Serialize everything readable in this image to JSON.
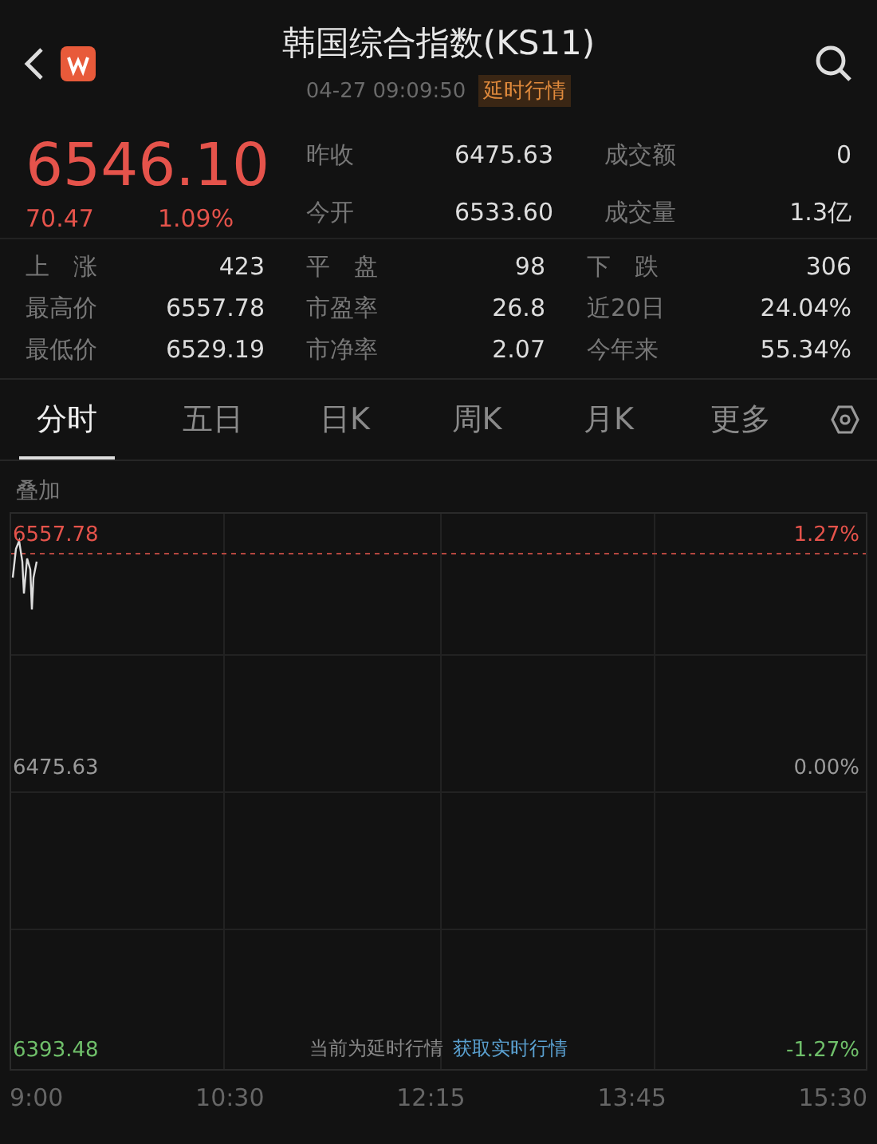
{
  "header": {
    "title": "韩国综合指数(KS11)",
    "datetime": "04-27 09:09:50",
    "badge": "延时行情"
  },
  "quote": {
    "price": "6546.10",
    "change": "70.47",
    "change_pct": "1.09%",
    "color": "#e5534b"
  },
  "quote_fields": [
    {
      "label": "昨收",
      "value": "6475.63"
    },
    {
      "label": "成交额",
      "value": "0"
    },
    {
      "label": "今开",
      "value": "6533.60"
    },
    {
      "label": "成交量",
      "value": "1.3亿"
    }
  ],
  "stats": [
    {
      "label": "上　涨",
      "value": "423"
    },
    {
      "label": "平　盘",
      "value": "98"
    },
    {
      "label": "下　跌",
      "value": "306"
    },
    {
      "label": "最高价",
      "value": "6557.78"
    },
    {
      "label": "市盈率",
      "value": "26.8"
    },
    {
      "label": "近20日",
      "value": "24.04%"
    },
    {
      "label": "最低价",
      "value": "6529.19"
    },
    {
      "label": "市净率",
      "value": "2.07"
    },
    {
      "label": "今年来",
      "value": "55.34%"
    }
  ],
  "tabs": [
    {
      "label": "分时",
      "selected": true
    },
    {
      "label": "五日",
      "selected": false
    },
    {
      "label": "日K",
      "selected": false
    },
    {
      "label": "周K",
      "selected": false
    },
    {
      "label": "月K",
      "selected": false
    },
    {
      "label": "更多",
      "selected": false
    }
  ],
  "chart": {
    "overlay_label": "叠加",
    "levels": [
      {
        "price": "6557.78",
        "pct": "1.27%",
        "color": "#e5534b"
      },
      {
        "price": "6475.63",
        "pct": "0.00%",
        "color": "#9a9a9a"
      },
      {
        "price": "6393.48",
        "pct": "-1.27%",
        "color": "#6fbf6a"
      }
    ],
    "x_labels": [
      "9:00",
      "10:30",
      "12:15",
      "13:45",
      "15:30"
    ],
    "notice": "当前为延时行情",
    "notice_link": "获取实时行情"
  }
}
